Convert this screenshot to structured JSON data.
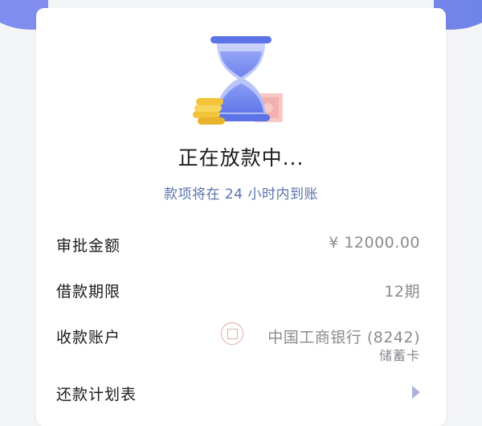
{
  "status": {
    "title": "正在放款中...",
    "subtitle": "款项将在 24 小时内到账",
    "illustration_icon": "hourglass-money-icon"
  },
  "details": {
    "approval_amount": {
      "label": "审批金额",
      "value": "¥ 12000.00"
    },
    "loan_term": {
      "label": "借款期限",
      "value": "12期"
    },
    "receiving_account": {
      "label": "收款账户",
      "bank_icon": "icbc-logo-icon",
      "bank": "中国工商银行 (8242)",
      "card_type": "储蓄卡"
    },
    "repayment_plan": {
      "label": "还款计划表",
      "action_icon": "chevron-right-icon"
    }
  },
  "colors": {
    "accent_blue": "#5a74ad",
    "hourglass_blue": "#5c73e8",
    "coin_gold": "#f3c33a",
    "banner_purple": "#7a86ea"
  }
}
